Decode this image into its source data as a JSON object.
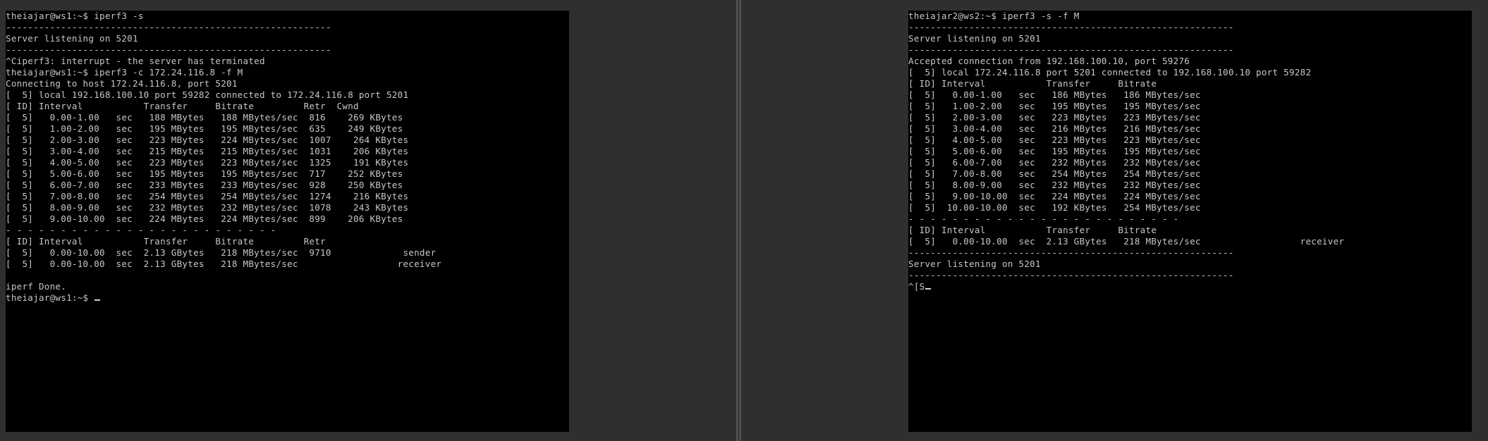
{
  "left_terminal": {
    "lines": [
      "theiajar@ws1:~$ iperf3 -s",
      "-----------------------------------------------------------",
      "Server listening on 5201",
      "-----------------------------------------------------------",
      "^Ciperf3: interrupt - the server has terminated",
      "theiajar@ws1:~$ iperf3 -c 172.24.116.8 -f M",
      "Connecting to host 172.24.116.8, port 5201",
      "[  5] local 192.168.100.10 port 59282 connected to 172.24.116.8 port 5201",
      "[ ID] Interval           Transfer     Bitrate         Retr  Cwnd",
      "[  5]   0.00-1.00   sec   188 MBytes   188 MBytes/sec  816    269 KBytes",
      "[  5]   1.00-2.00   sec   195 MBytes   195 MBytes/sec  635    249 KBytes",
      "[  5]   2.00-3.00   sec   223 MBytes   224 MBytes/sec  1007    264 KBytes",
      "[  5]   3.00-4.00   sec   215 MBytes   215 MBytes/sec  1031    206 KBytes",
      "[  5]   4.00-5.00   sec   223 MBytes   223 MBytes/sec  1325    191 KBytes",
      "[  5]   5.00-6.00   sec   195 MBytes   195 MBytes/sec  717    252 KBytes",
      "[  5]   6.00-7.00   sec   233 MBytes   233 MBytes/sec  928    250 KBytes",
      "[  5]   7.00-8.00   sec   254 MBytes   254 MBytes/sec  1274    216 KBytes",
      "[  5]   8.00-9.00   sec   232 MBytes   232 MBytes/sec  1078    243 KBytes",
      "[  5]   9.00-10.00  sec   224 MBytes   224 MBytes/sec  899    206 KBytes",
      "- - - - - - - - - - - - - - - - - - - - - - - - -",
      "[ ID] Interval           Transfer     Bitrate         Retr",
      "[  5]   0.00-10.00  sec  2.13 GBytes   218 MBytes/sec  9710             sender",
      "[  5]   0.00-10.00  sec  2.13 GBytes   218 MBytes/sec                  receiver",
      "",
      "iperf Done.",
      "theiajar@ws1:~$ "
    ]
  },
  "right_terminal": {
    "lines": [
      "theiajar2@ws2:~$ iperf3 -s -f M",
      "-----------------------------------------------------------",
      "Server listening on 5201",
      "-----------------------------------------------------------",
      "Accepted connection from 192.168.100.10, port 59276",
      "[  5] local 172.24.116.8 port 5201 connected to 192.168.100.10 port 59282",
      "[ ID] Interval           Transfer     Bitrate",
      "[  5]   0.00-1.00   sec   186 MBytes   186 MBytes/sec",
      "[  5]   1.00-2.00   sec   195 MBytes   195 MBytes/sec",
      "[  5]   2.00-3.00   sec   223 MBytes   223 MBytes/sec",
      "[  5]   3.00-4.00   sec   216 MBytes   216 MBytes/sec",
      "[  5]   4.00-5.00   sec   223 MBytes   223 MBytes/sec",
      "[  5]   5.00-6.00   sec   195 MBytes   195 MBytes/sec",
      "[  5]   6.00-7.00   sec   232 MBytes   232 MBytes/sec",
      "[  5]   7.00-8.00   sec   254 MBytes   254 MBytes/sec",
      "[  5]   8.00-9.00   sec   232 MBytes   232 MBytes/sec",
      "[  5]   9.00-10.00  sec   224 MBytes   224 MBytes/sec",
      "[  5]  10.00-10.00  sec   192 KBytes   254 MBytes/sec",
      "- - - - - - - - - - - - - - - - - - - - - - - - -",
      "[ ID] Interval           Transfer     Bitrate",
      "[  5]   0.00-10.00  sec  2.13 GBytes   218 MBytes/sec                  receiver",
      "-----------------------------------------------------------",
      "Server listening on 5201",
      "-----------------------------------------------------------",
      "^[S"
    ]
  }
}
